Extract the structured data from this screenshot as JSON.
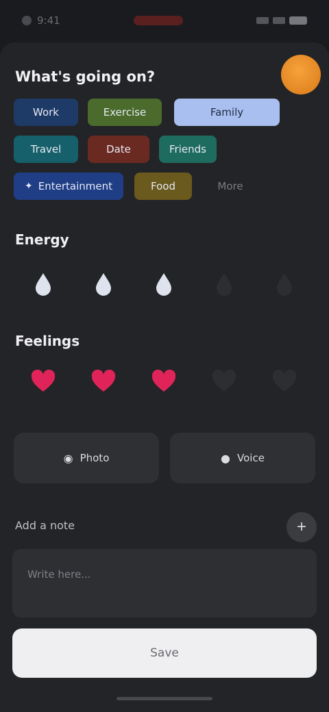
{
  "status_bar": {
    "time": "9:41"
  },
  "prompt": {
    "title": "What's going on?"
  },
  "tags": [
    {
      "label": "Work",
      "bg": "#1e3a66"
    },
    {
      "label": "Exercise",
      "bg": "#4a6b2c"
    },
    {
      "label": "Family",
      "bg": "#a9bff0"
    },
    {
      "label": "Travel",
      "bg": "#15606a"
    },
    {
      "label": "Date",
      "bg": "#6a2a22"
    },
    {
      "label": "Friends",
      "bg": "#1e6b60"
    },
    {
      "label": "Entertainment",
      "bg": "#1f3e86"
    },
    {
      "label": "Food",
      "bg": "#6a5a1e"
    },
    {
      "label": "More",
      "bg": "transparent"
    }
  ],
  "energy": {
    "heading": "Energy",
    "level": 3,
    "max": 5,
    "filled_color": "#dfe3ee",
    "empty_color": "#2d2e32"
  },
  "feelings": {
    "heading": "Feelings",
    "level": 3,
    "max": 5,
    "filled_color": "#e0245a",
    "empty_color": "#2d2e32"
  },
  "actions": {
    "photo_label": "Photo",
    "voice_label": "Voice"
  },
  "notes": {
    "label": "Add a note",
    "placeholder": "Write here..."
  },
  "save": {
    "label": "Save"
  }
}
